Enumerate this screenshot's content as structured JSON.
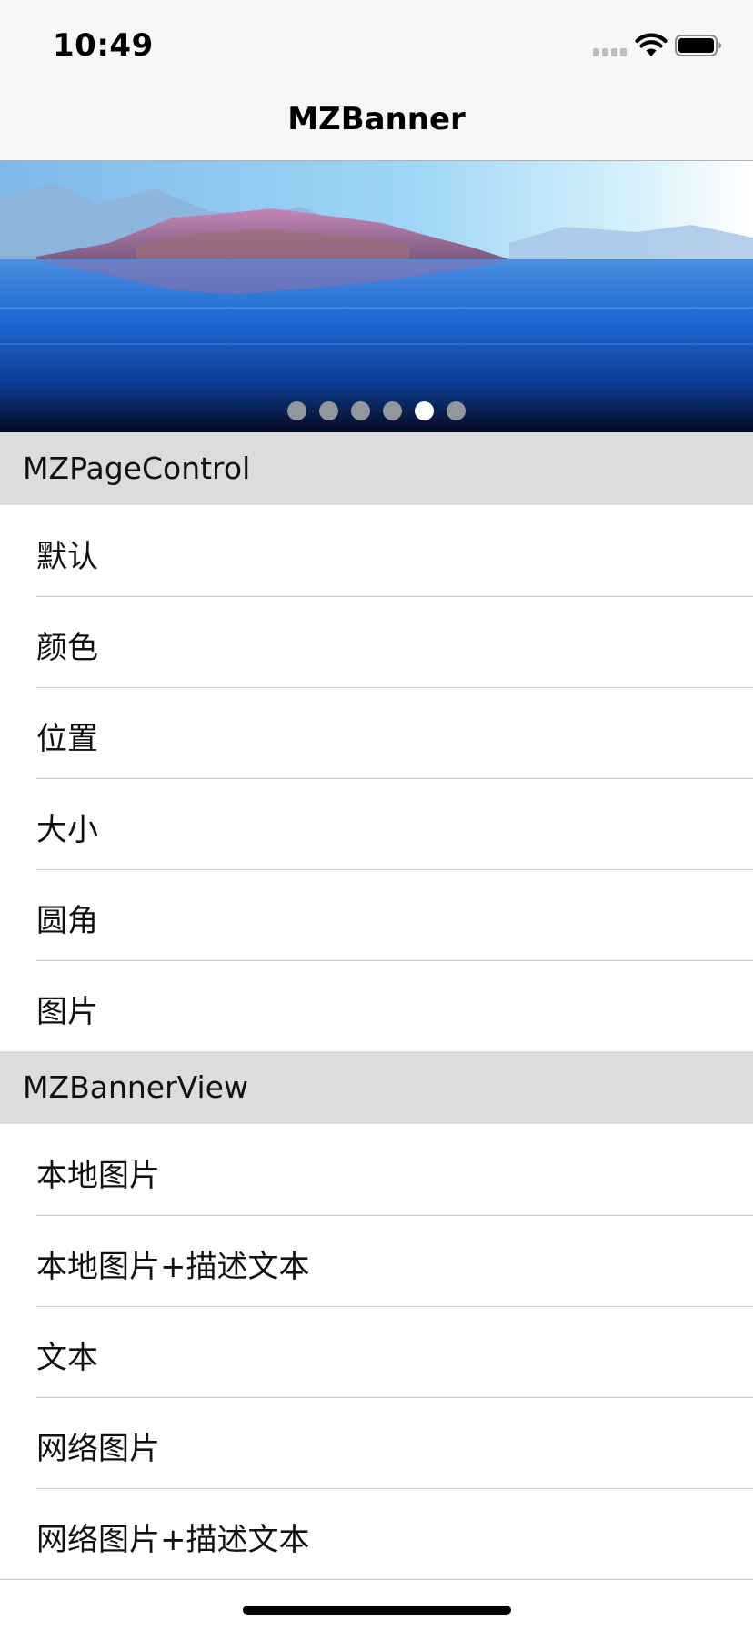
{
  "status_bar": {
    "time": "10:49",
    "signal_icon": "cellular-signal-icon",
    "wifi_icon": "wifi-icon",
    "battery_icon": "battery-icon"
  },
  "nav": {
    "title": "MZBanner"
  },
  "banner": {
    "image": "lake-landscape-photo",
    "page_count": 6,
    "current_page_index": 4,
    "active_dot_color": "#ffffff",
    "inactive_dot_color": "#aaaaaa"
  },
  "sections": [
    {
      "header": "MZPageControl",
      "rows": [
        "默认",
        "颜色",
        "位置",
        "大小",
        "圆角",
        "图片"
      ]
    },
    {
      "header": "MZBannerView",
      "rows": [
        "本地图片",
        "本地图片+描述文本",
        "文本",
        "网络图片",
        "网络图片+描述文本"
      ]
    }
  ],
  "colors": {
    "section_header_bg": "#dcdcdc",
    "separator": "#c8c7cc",
    "bar_bg": "#f7f7f7"
  }
}
